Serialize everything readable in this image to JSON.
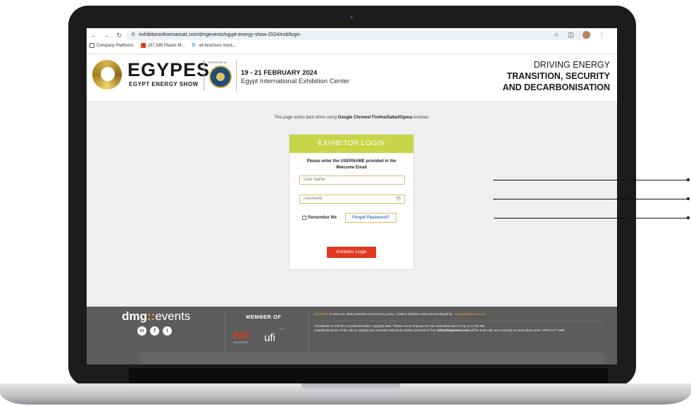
{
  "browser": {
    "url": "exhibitoronlinemanual.com/dmgevents/egypt-energy-show-2024/exb/login",
    "bookmarks": [
      "Company Platforms",
      "197,585 Plastic M...",
      "a4 brochure mock..."
    ]
  },
  "header": {
    "brand": "EGYPES",
    "brand_sub": "EGYPT ENERGY SHOW",
    "supported_by": "SUPPORTED BY",
    "dates": "19 - 21 FEBRUARY 2024",
    "venue": "Egypt International Exhibition Center",
    "tagline_1": "DRIVING ENERGY",
    "tagline_2": "TRANSITION, SECURITY",
    "tagline_3": "AND DECARBONISATION"
  },
  "notice": {
    "prefix": "This page works best when using",
    "browsers": "Google Chrome/ Firefox/Safari/Opera",
    "suffix": "browser."
  },
  "login": {
    "title": "EXHIBITOR LOGIN",
    "instruction": "Please enter the USERNAME provided in the Welcome Email",
    "username_placeholder": "User Name",
    "password_placeholder": "Password",
    "remember_label": "Remember Me",
    "forgot_label": "Forgot Password?",
    "submit_label": "Exhibitor Login"
  },
  "footer": {
    "brand_a": "dmg",
    "brand_colons": "::",
    "brand_b": "events",
    "member_of": "MEMBER OF",
    "aeo": "AEO",
    "aeo_sub": "MEMBER",
    "ufi": "ufi",
    "link_click": "Click here",
    "link_text": "to view our data protection and privacy policy. | Online Exhibitor Manual Developed by :",
    "developer": "www.xsperience.com",
    "disclaimer_1": "All material on this site is protected under copyright laws. Please ensure that you are the authorized user to log on to this site.",
    "disclaimer_2": "Unauthorised use of this site or copying any materials without the written permission from",
    "email": "info@dmgevents.com",
    "disclaimer_3": "will be dealt with very seriously as prescribed under CPDA ACT 1998."
  }
}
